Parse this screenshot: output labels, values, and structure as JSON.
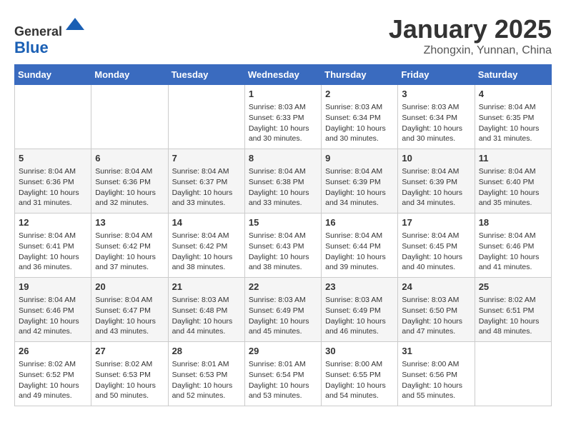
{
  "header": {
    "logo_line1": "General",
    "logo_line2": "Blue",
    "month_year": "January 2025",
    "location": "Zhongxin, Yunnan, China"
  },
  "weekdays": [
    "Sunday",
    "Monday",
    "Tuesday",
    "Wednesday",
    "Thursday",
    "Friday",
    "Saturday"
  ],
  "weeks": [
    [
      {
        "day": "",
        "info": ""
      },
      {
        "day": "",
        "info": ""
      },
      {
        "day": "",
        "info": ""
      },
      {
        "day": "1",
        "info": "Sunrise: 8:03 AM\nSunset: 6:33 PM\nDaylight: 10 hours\nand 30 minutes."
      },
      {
        "day": "2",
        "info": "Sunrise: 8:03 AM\nSunset: 6:34 PM\nDaylight: 10 hours\nand 30 minutes."
      },
      {
        "day": "3",
        "info": "Sunrise: 8:03 AM\nSunset: 6:34 PM\nDaylight: 10 hours\nand 30 minutes."
      },
      {
        "day": "4",
        "info": "Sunrise: 8:04 AM\nSunset: 6:35 PM\nDaylight: 10 hours\nand 31 minutes."
      }
    ],
    [
      {
        "day": "5",
        "info": "Sunrise: 8:04 AM\nSunset: 6:36 PM\nDaylight: 10 hours\nand 31 minutes."
      },
      {
        "day": "6",
        "info": "Sunrise: 8:04 AM\nSunset: 6:36 PM\nDaylight: 10 hours\nand 32 minutes."
      },
      {
        "day": "7",
        "info": "Sunrise: 8:04 AM\nSunset: 6:37 PM\nDaylight: 10 hours\nand 33 minutes."
      },
      {
        "day": "8",
        "info": "Sunrise: 8:04 AM\nSunset: 6:38 PM\nDaylight: 10 hours\nand 33 minutes."
      },
      {
        "day": "9",
        "info": "Sunrise: 8:04 AM\nSunset: 6:39 PM\nDaylight: 10 hours\nand 34 minutes."
      },
      {
        "day": "10",
        "info": "Sunrise: 8:04 AM\nSunset: 6:39 PM\nDaylight: 10 hours\nand 34 minutes."
      },
      {
        "day": "11",
        "info": "Sunrise: 8:04 AM\nSunset: 6:40 PM\nDaylight: 10 hours\nand 35 minutes."
      }
    ],
    [
      {
        "day": "12",
        "info": "Sunrise: 8:04 AM\nSunset: 6:41 PM\nDaylight: 10 hours\nand 36 minutes."
      },
      {
        "day": "13",
        "info": "Sunrise: 8:04 AM\nSunset: 6:42 PM\nDaylight: 10 hours\nand 37 minutes."
      },
      {
        "day": "14",
        "info": "Sunrise: 8:04 AM\nSunset: 6:42 PM\nDaylight: 10 hours\nand 38 minutes."
      },
      {
        "day": "15",
        "info": "Sunrise: 8:04 AM\nSunset: 6:43 PM\nDaylight: 10 hours\nand 38 minutes."
      },
      {
        "day": "16",
        "info": "Sunrise: 8:04 AM\nSunset: 6:44 PM\nDaylight: 10 hours\nand 39 minutes."
      },
      {
        "day": "17",
        "info": "Sunrise: 8:04 AM\nSunset: 6:45 PM\nDaylight: 10 hours\nand 40 minutes."
      },
      {
        "day": "18",
        "info": "Sunrise: 8:04 AM\nSunset: 6:46 PM\nDaylight: 10 hours\nand 41 minutes."
      }
    ],
    [
      {
        "day": "19",
        "info": "Sunrise: 8:04 AM\nSunset: 6:46 PM\nDaylight: 10 hours\nand 42 minutes."
      },
      {
        "day": "20",
        "info": "Sunrise: 8:04 AM\nSunset: 6:47 PM\nDaylight: 10 hours\nand 43 minutes."
      },
      {
        "day": "21",
        "info": "Sunrise: 8:03 AM\nSunset: 6:48 PM\nDaylight: 10 hours\nand 44 minutes."
      },
      {
        "day": "22",
        "info": "Sunrise: 8:03 AM\nSunset: 6:49 PM\nDaylight: 10 hours\nand 45 minutes."
      },
      {
        "day": "23",
        "info": "Sunrise: 8:03 AM\nSunset: 6:49 PM\nDaylight: 10 hours\nand 46 minutes."
      },
      {
        "day": "24",
        "info": "Sunrise: 8:03 AM\nSunset: 6:50 PM\nDaylight: 10 hours\nand 47 minutes."
      },
      {
        "day": "25",
        "info": "Sunrise: 8:02 AM\nSunset: 6:51 PM\nDaylight: 10 hours\nand 48 minutes."
      }
    ],
    [
      {
        "day": "26",
        "info": "Sunrise: 8:02 AM\nSunset: 6:52 PM\nDaylight: 10 hours\nand 49 minutes."
      },
      {
        "day": "27",
        "info": "Sunrise: 8:02 AM\nSunset: 6:53 PM\nDaylight: 10 hours\nand 50 minutes."
      },
      {
        "day": "28",
        "info": "Sunrise: 8:01 AM\nSunset: 6:53 PM\nDaylight: 10 hours\nand 52 minutes."
      },
      {
        "day": "29",
        "info": "Sunrise: 8:01 AM\nSunset: 6:54 PM\nDaylight: 10 hours\nand 53 minutes."
      },
      {
        "day": "30",
        "info": "Sunrise: 8:00 AM\nSunset: 6:55 PM\nDaylight: 10 hours\nand 54 minutes."
      },
      {
        "day": "31",
        "info": "Sunrise: 8:00 AM\nSunset: 6:56 PM\nDaylight: 10 hours\nand 55 minutes."
      },
      {
        "day": "",
        "info": ""
      }
    ]
  ]
}
